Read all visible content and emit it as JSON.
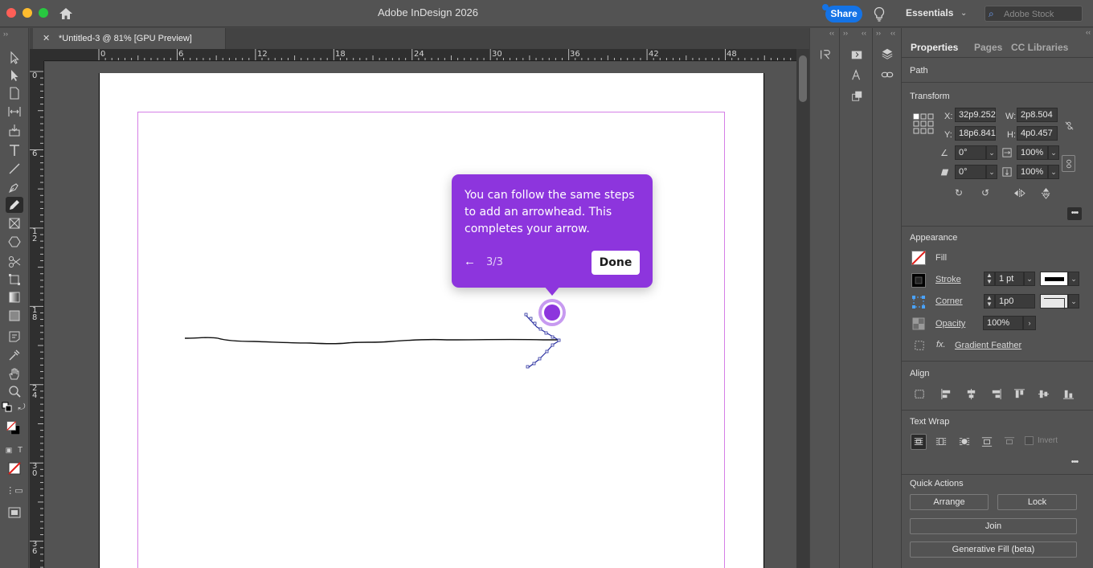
{
  "app": {
    "title": "Adobe InDesign 2026",
    "share_label": "Share",
    "workspace": "Essentials",
    "stock_placeholder": "Adobe Stock"
  },
  "document_tab": {
    "label": "*Untitled-3 @ 81% [GPU Preview]"
  },
  "ruler": {
    "h_labels": [
      "0",
      "6",
      "12",
      "18",
      "24",
      "30",
      "36",
      "42",
      "48"
    ],
    "v_labels": [
      "0",
      "6",
      "1\n2",
      "1\n8",
      "2\n4",
      "3\n0",
      "3\n6"
    ]
  },
  "coach_mark": {
    "message": "You can follow the same steps to add an arrowhead. This completes your arrow.",
    "step": "3/3",
    "done_label": "Done"
  },
  "properties": {
    "tabs": [
      "Properties",
      "Pages",
      "CC Libraries"
    ],
    "object_type": "Path",
    "transform": {
      "title": "Transform",
      "x_label": "X:",
      "x": "32p9.252",
      "y_label": "Y:",
      "y": "18p6.841",
      "w_label": "W:",
      "w": "2p8.504",
      "h_label": "H:",
      "h": "4p0.457",
      "rotate": "0°",
      "shear": "0°",
      "scale_x": "100%",
      "scale_y": "100%"
    },
    "appearance": {
      "title": "Appearance",
      "fill_label": "Fill",
      "stroke_label": "Stroke",
      "stroke_value": "1 pt",
      "corner_label": "Corner",
      "corner_value": "1p0",
      "opacity_label": "Opacity",
      "opacity_value": "100%",
      "effect_label": "Gradient Feather"
    },
    "align": {
      "title": "Align"
    },
    "text_wrap": {
      "title": "Text Wrap",
      "invert_label": "Invert"
    },
    "quick_actions": {
      "title": "Quick Actions",
      "arrange": "Arrange",
      "lock": "Lock",
      "join": "Join",
      "generative_fill": "Generative Fill (beta)"
    }
  },
  "colors": {
    "accent_purple": "#8d35dd",
    "share_blue": "#1473e6",
    "margin_guide": "#d57fe6"
  }
}
